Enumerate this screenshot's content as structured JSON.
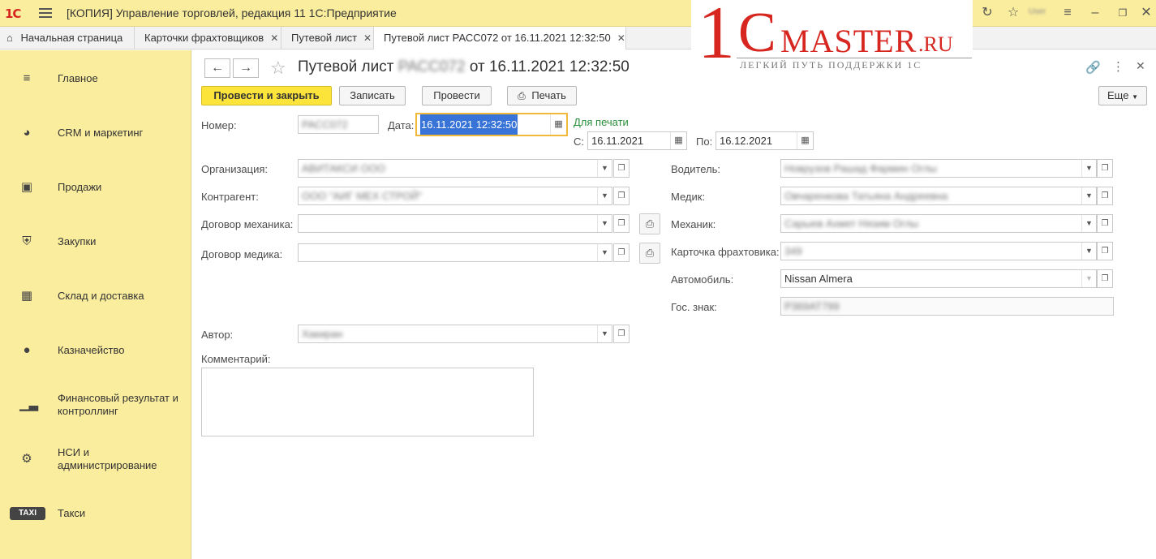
{
  "titlebar": {
    "logo": "1С",
    "app_title": "[КОПИЯ] Управление торговлей, редакция 11 1С:Предприятие",
    "user": "User"
  },
  "tabs": [
    {
      "label": "Начальная страница"
    },
    {
      "label": "Карточки фрахтовщиков"
    },
    {
      "label": "Путевой лист"
    },
    {
      "label": "Путевой лист РАСС072 от 16.11.2021 12:32:50"
    }
  ],
  "watermark": {
    "one": "1",
    "c": "C",
    "master": "MASTER",
    "ru": ".RU",
    "subtitle": "ЛЕГКИЙ ПУТЬ ПОДДЕРЖКИ 1С"
  },
  "sidebar": {
    "items": [
      {
        "label": "Главное",
        "icon": "menu-icon"
      },
      {
        "label": "CRM и маркетинг",
        "icon": "pie-chart-icon"
      },
      {
        "label": "Продажи",
        "icon": "shopping-bag-icon"
      },
      {
        "label": "Закупки",
        "icon": "cart-icon"
      },
      {
        "label": "Склад и доставка",
        "icon": "grid-icon"
      },
      {
        "label": "Казначейство",
        "icon": "ruble-icon"
      },
      {
        "label": "Финансовый результат и контроллинг",
        "icon": "bar-chart-icon"
      },
      {
        "label": "НСИ и администрирование",
        "icon": "gear-icon"
      },
      {
        "label": "Такси",
        "icon": "taxi-icon"
      }
    ]
  },
  "document": {
    "title_prefix": "Путевой лист",
    "title_number": "РАСС072",
    "title_suffix": "от 16.11.2021 12:32:50"
  },
  "toolbar": {
    "post_close": "Провести и закрыть",
    "save": "Записать",
    "post": "Провести",
    "print": "Печать",
    "more": "Еще"
  },
  "form": {
    "number_label": "Номер:",
    "number_value": "РАСС072",
    "date_label": "Дата:",
    "date_value": "16.11.2021 12:32:50",
    "for_print": "Для печати",
    "from_label": "С:",
    "from_value": "16.11.2021",
    "to_label": "По:",
    "to_value": "16.12.2021",
    "org_label": "Организация:",
    "org_value": "АВИТАКСИ ООО",
    "counterparty_label": "Контрагент:",
    "counterparty_value": "ООО \"АИГ МЕХ СТРОЙ\"",
    "mech_contract_label": "Договор механика:",
    "mech_contract_value": "",
    "med_contract_label": "Договор медика:",
    "med_contract_value": "",
    "driver_label": "Водитель:",
    "driver_value": "Новрузов Рашад Фармин Оглы",
    "medic_label": "Медик:",
    "medic_value": "Овчаренкова Татьяна Андреевна",
    "mechanic_label": "Механик:",
    "mechanic_value": "Сарыев Ахмет Нязим Оглы",
    "card_label": "Карточка фрахтовика:",
    "card_value": "349",
    "car_label": "Автомобиль:",
    "car_value": "Nissan Almera",
    "plate_label": "Гос. знак:",
    "plate_value": "Р369АТ799",
    "author_label": "Автор:",
    "author_value": "Хакиран",
    "comment_label": "Комментарий:",
    "comment_value": ""
  }
}
